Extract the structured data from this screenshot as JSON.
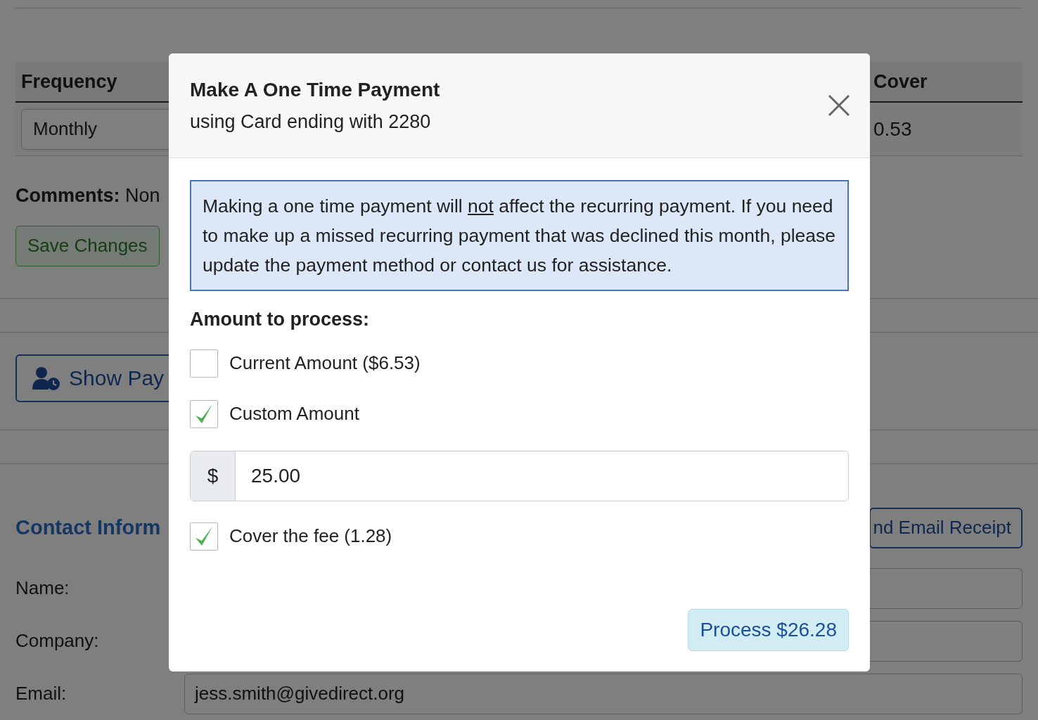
{
  "page": {
    "table": {
      "columns": [
        "Frequency",
        "Cover"
      ],
      "row": {
        "frequency": "Monthly",
        "cover": "0.53"
      }
    },
    "comments": {
      "label": "Comments:",
      "value": "Non"
    },
    "save_button": "Save Changes",
    "show_button": "Show Pay",
    "contact_heading": "Contact Inform",
    "receipt_button": "nd Email Receipt",
    "fields": [
      {
        "label": "Name:"
      },
      {
        "label": "Company:"
      },
      {
        "label": "Email:",
        "value": "jess.smith@givedirect.org"
      }
    ]
  },
  "modal": {
    "title": "Make A One Time Payment",
    "subtitle": "using Card ending with 2280",
    "notice": {
      "before": "Making a one time payment will ",
      "underlined": "not",
      "after": " affect the recurring payment. If you need to make up a missed recurring payment that was declined this month, please update the payment method or contact us for assistance."
    },
    "amount_label": "Amount to process:",
    "options": [
      {
        "label": "Current Amount ($6.53)",
        "checked": false
      },
      {
        "label": "Custom Amount",
        "checked": true
      }
    ],
    "amount_field": {
      "prefix": "$",
      "value": "25.00"
    },
    "fee_option": {
      "label": "Cover the fee (1.28)",
      "checked": true
    },
    "process_button": "Process $26.28"
  }
}
